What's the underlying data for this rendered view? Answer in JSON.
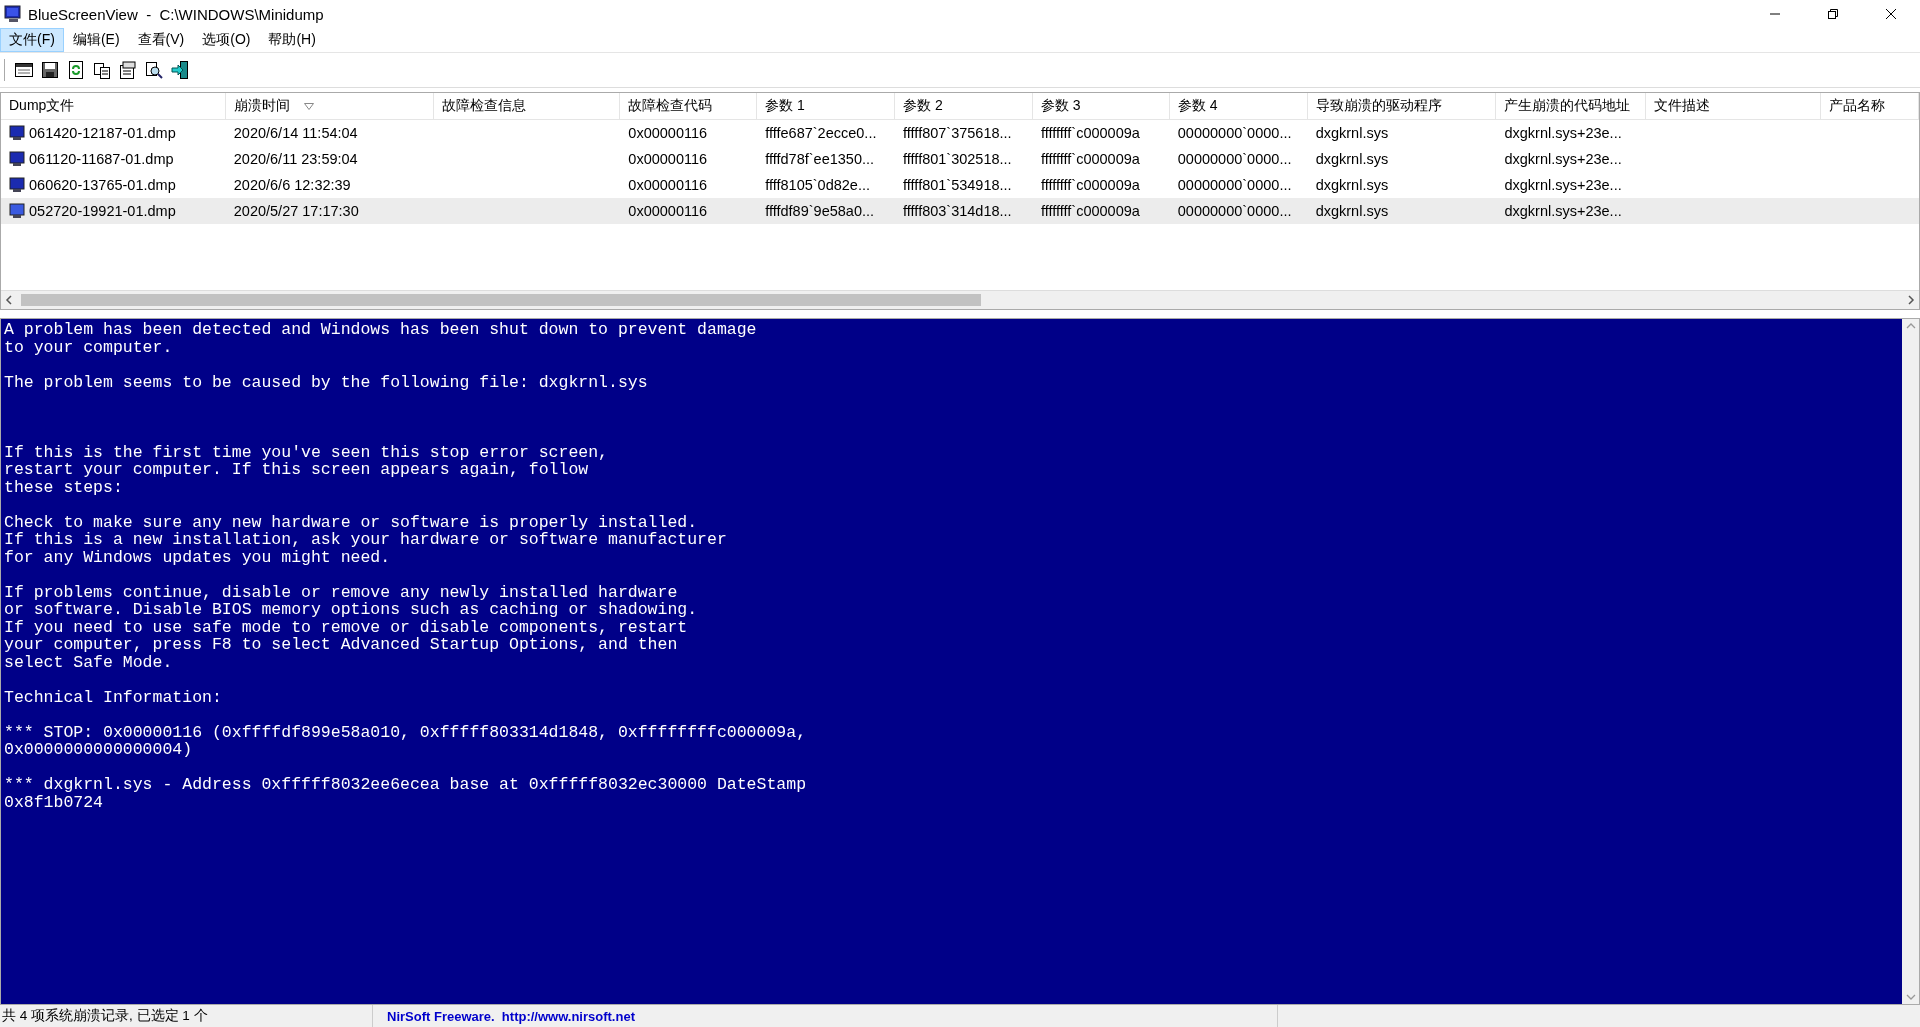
{
  "window": {
    "title": "BlueScreenView  -  C:\\WINDOWS\\Minidump"
  },
  "menu": [
    {
      "label": "文件(F)",
      "selected": true
    },
    {
      "label": "编辑(E)",
      "selected": false
    },
    {
      "label": "查看(V)",
      "selected": false
    },
    {
      "label": "选项(O)",
      "selected": false
    },
    {
      "label": "帮助(H)",
      "selected": false
    }
  ],
  "table": {
    "columns": [
      {
        "label": "Dump文件",
        "sorted": false
      },
      {
        "label": "崩溃时间",
        "sorted": true
      },
      {
        "label": "故障检查信息",
        "sorted": false
      },
      {
        "label": "故障检查代码",
        "sorted": false
      },
      {
        "label": "参数 1",
        "sorted": false
      },
      {
        "label": "参数 2",
        "sorted": false
      },
      {
        "label": "参数 3",
        "sorted": false
      },
      {
        "label": "参数 4",
        "sorted": false
      },
      {
        "label": "导致崩溃的驱动程序",
        "sorted": false
      },
      {
        "label": "产生崩溃的代码地址",
        "sorted": false
      },
      {
        "label": "文件描述",
        "sorted": false
      },
      {
        "label": "产品名称",
        "sorted": false
      }
    ],
    "rows": [
      {
        "selected": false,
        "file": "061420-12187-01.dmp",
        "time": "2020/6/14 11:54:04",
        "bugcheck_code": "0x00000116",
        "param_1": "ffffe687`2ecce0...",
        "param_2": "fffff807`375618...",
        "param_3": "ffffffff`c000009a",
        "param_4": "00000000`0000...",
        "driver": "dxgkrnl.sys",
        "crash_address": "dxgkrnl.sys+23e..."
      },
      {
        "selected": false,
        "file": "061120-11687-01.dmp",
        "time": "2020/6/11 23:59:04",
        "bugcheck_code": "0x00000116",
        "param_1": "ffffd78f`ee1350...",
        "param_2": "fffff801`302518...",
        "param_3": "ffffffff`c000009a",
        "param_4": "00000000`0000...",
        "driver": "dxgkrnl.sys",
        "crash_address": "dxgkrnl.sys+23e..."
      },
      {
        "selected": false,
        "file": "060620-13765-01.dmp",
        "time": "2020/6/6 12:32:39",
        "bugcheck_code": "0x00000116",
        "param_1": "ffff8105`0d82e...",
        "param_2": "fffff801`534918...",
        "param_3": "ffffffff`c000009a",
        "param_4": "00000000`0000...",
        "driver": "dxgkrnl.sys",
        "crash_address": "dxgkrnl.sys+23e..."
      },
      {
        "selected": true,
        "file": "052720-19921-01.dmp",
        "time": "2020/5/27 17:17:30",
        "bugcheck_code": "0x00000116",
        "param_1": "ffffdf89`9e58a0...",
        "param_2": "fffff803`314d18...",
        "param_3": "ffffffff`c000009a",
        "param_4": "00000000`0000...",
        "driver": "dxgkrnl.sys",
        "crash_address": "dxgkrnl.sys+23e..."
      }
    ]
  },
  "bluescreen": {
    "text": "A problem has been detected and Windows has been shut down to prevent damage\nto your computer.\n\nThe problem seems to be caused by the following file: dxgkrnl.sys\n\n\n\nIf this is the first time you've seen this stop error screen,\nrestart your computer. If this screen appears again, follow\nthese steps:\n\nCheck to make sure any new hardware or software is properly installed.\nIf this is a new installation, ask your hardware or software manufacturer\nfor any Windows updates you might need.\n\nIf problems continue, disable or remove any newly installed hardware\nor software. Disable BIOS memory options such as caching or shadowing.\nIf you need to use safe mode to remove or disable components, restart\nyour computer, press F8 to select Advanced Startup Options, and then\nselect Safe Mode.\n\nTechnical Information:\n\n*** STOP: 0x00000116 (0xffffdf899e58a010, 0xfffff803314d1848, 0xffffffffc000009a,\n0x0000000000000004)\n\n*** dxgkrnl.sys - Address 0xfffff8032ee6ecea base at 0xfffff8032ec30000 DateStamp\n0x8f1b0724"
  },
  "status_bar": {
    "summary": "共 4 项系统崩溃记录, 已选定 1 个",
    "credit": "NirSoft Freeware.  http://www.nirsoft.net"
  }
}
